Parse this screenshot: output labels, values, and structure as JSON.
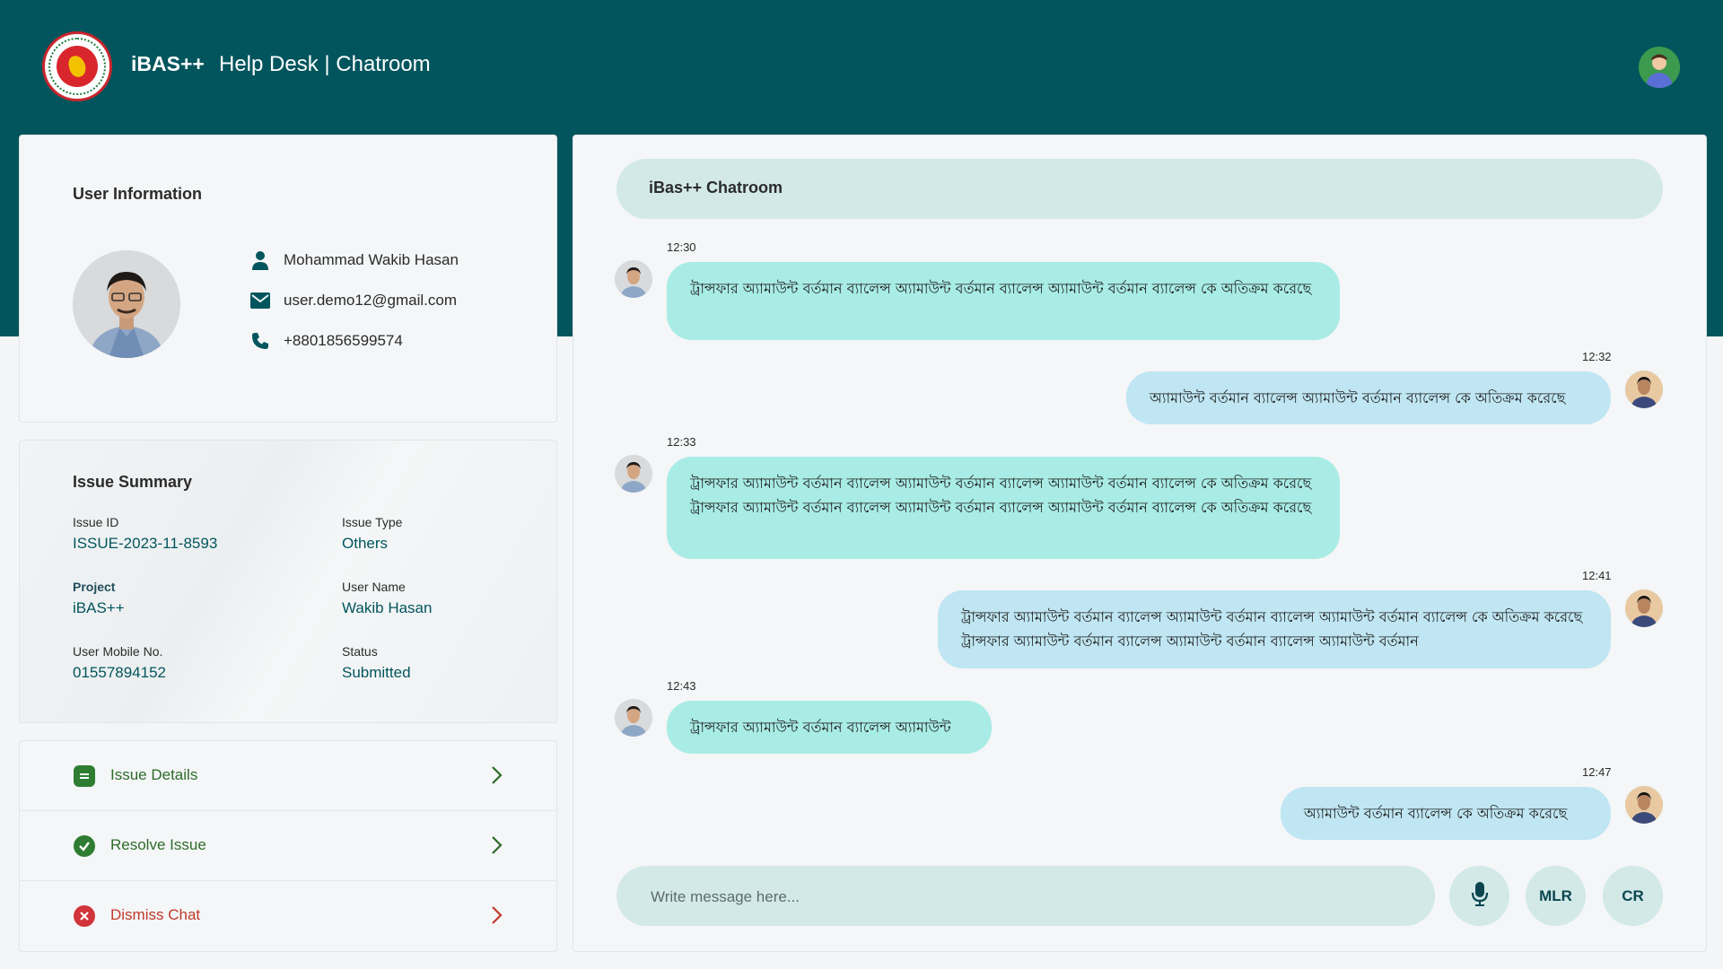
{
  "header": {
    "app_name": "iBAS++",
    "page_title": "Help Desk | Chatroom"
  },
  "user_info": {
    "title": "User Information",
    "name": "Mohammad Wakib Hasan",
    "email": "user.demo12@gmail.com",
    "phone": "+8801856599574"
  },
  "issue_summary": {
    "title": "Issue Summary",
    "fields": [
      {
        "label": "Issue ID",
        "value": "ISSUE-2023-11-8593"
      },
      {
        "label": "Issue Type",
        "value": "Others"
      },
      {
        "label": "Project",
        "value": "iBAS++"
      },
      {
        "label": "User Name",
        "value": "Wakib Hasan"
      },
      {
        "label": "User Mobile No.",
        "value": "01557894152"
      },
      {
        "label": "Status",
        "value": "Submitted"
      }
    ]
  },
  "actions": [
    {
      "label": "Issue Details",
      "icon": "document-icon",
      "color": "#2e6b2a"
    },
    {
      "label": "Resolve Issue",
      "icon": "check-circle-icon",
      "color": "#2e6b2a"
    },
    {
      "label": "Dismiss Chat",
      "icon": "close-circle-icon",
      "color": "#c0392b"
    }
  ],
  "chat": {
    "title": "iBas++ Chatroom",
    "messages": [
      {
        "time": "12:30",
        "direction": "incoming",
        "text": "ট্রান্সফার অ্যামাউন্ট বর্তমান ব্যালেন্স অ্যামাউন্ট বর্তমান ব্যালেন্স অ্যামাউন্ট বর্তমান ব্যালেন্স কে অতিক্রম করেছে"
      },
      {
        "time": "12:32",
        "direction": "outgoing",
        "text": "অ্যামাউন্ট বর্তমান ব্যালেন্স অ্যামাউন্ট বর্তমান ব্যালেন্স কে অতিক্রম করেছে"
      },
      {
        "time": "12:33",
        "direction": "incoming",
        "text": "ট্রান্সফার অ্যামাউন্ট বর্তমান ব্যালেন্স অ্যামাউন্ট বর্তমান ব্যালেন্স অ্যামাউন্ট বর্তমান ব্যালেন্স কে অতিক্রম করেছে ট্রান্সফার অ্যামাউন্ট বর্তমান ব্যালেন্স অ্যামাউন্ট বর্তমান ব্যালেন্স অ্যামাউন্ট বর্তমান ব্যালেন্স কে অতিক্রম করেছে"
      },
      {
        "time": "12:41",
        "direction": "outgoing",
        "text": "ট্রান্সফার অ্যামাউন্ট বর্তমান ব্যালেন্স অ্যামাউন্ট বর্তমান ব্যালেন্স অ্যামাউন্ট বর্তমান ব্যালেন্স কে অতিক্রম করেছে ট্রান্সফার অ্যামাউন্ট বর্তমান ব্যালেন্স অ্যামাউন্ট বর্তমান ব্যালেন্স অ্যামাউন্ট বর্তমান"
      },
      {
        "time": "12:43",
        "direction": "incoming",
        "text": "ট্রান্সফার অ্যামাউন্ট বর্তমান ব্যালেন্স অ্যামাউন্ট"
      },
      {
        "time": "12:47",
        "direction": "outgoing",
        "text": "অ্যামাউন্ট বর্তমান ব্যালেন্স কে অতিক্রম করেছে"
      }
    ],
    "composer_placeholder": "Write message here...",
    "buttons": {
      "mic": "microphone-icon",
      "mlr": "MLR",
      "cr": "CR"
    }
  },
  "colors": {
    "brand": "#02555d",
    "incoming_bubble": "#a8ece5",
    "outgoing_bubble": "#bfe6f2",
    "pill": "#d2e9e8"
  }
}
